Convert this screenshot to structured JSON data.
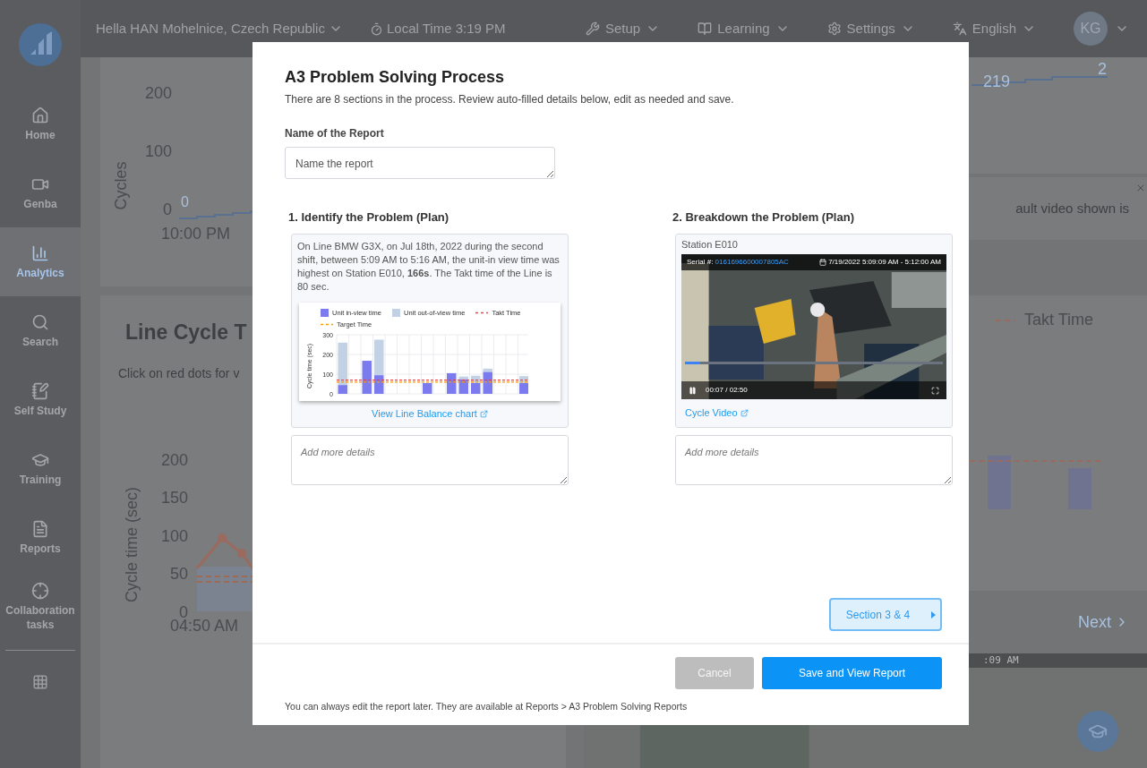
{
  "top_bar": {
    "site": "Hella HAN Mohelnice, Czech Republic",
    "local_time": "Local Time 3:19 PM",
    "menus": [
      {
        "kind": "setup",
        "label": "Setup"
      },
      {
        "kind": "learning",
        "label": "Learning"
      },
      {
        "kind": "settings",
        "label": "Settings"
      },
      {
        "kind": "language",
        "label": "English"
      }
    ],
    "avatar": "KG"
  },
  "sidebar": {
    "items": [
      {
        "kind": "home",
        "label": "Home",
        "selected": false
      },
      {
        "kind": "video",
        "label": "Genba",
        "selected": false
      },
      {
        "kind": "analytics",
        "label": "Analytics",
        "selected": true
      },
      {
        "kind": "search",
        "label": "Search",
        "selected": false
      },
      {
        "kind": "study",
        "label": "Self Study",
        "selected": false
      },
      {
        "kind": "training",
        "label": "Training",
        "selected": false
      },
      {
        "kind": "reports",
        "label": "Reports",
        "selected": false
      },
      {
        "kind": "collab",
        "label": "Collaboration tasks",
        "selected": false
      }
    ]
  },
  "background": {
    "cycles_chart": {
      "ylabel": "Cycles",
      "yticks": [
        "200",
        "100",
        "0"
      ],
      "xtick": "10:00 PM",
      "start_label": "0",
      "mid_label": "219",
      "end_label": "2"
    },
    "notice": "ault video shown is",
    "legend": "Takt Time",
    "next_link": "Next",
    "video_time": ":09 AM",
    "line_chart": {
      "title": "Line Cycle T",
      "subtitle": "Click on red dots for v",
      "ylabel": "Cycle time (sec)",
      "yticks": [
        "200",
        "150",
        "100",
        "50",
        "0"
      ],
      "xtick": "04:50 AM"
    }
  },
  "modal": {
    "title": "A3 Problem Solving Process",
    "subtitle": "There are 8 sections in the process. Review auto-filled details below, edit as needed and save.",
    "name_label": "Name of the Report",
    "name_placeholder": "Name the report",
    "sections": [
      {
        "kind": "summary",
        "title": "1. Identify the Problem (Plan)",
        "text": "On Line BMW G3X, on Jul 18th, 2022 during the second shift, between 5:09 AM to 5:16 AM, the unit-in view time was highest on Station E010, **166s**. The Takt time of the Line is 80 sec.",
        "link": "View Line Balance chart",
        "details_placeholder": "Add more details",
        "chart_data": {
          "type": "bar",
          "stacked": true,
          "legend": "top",
          "ylabel": "Cycle time (sec)",
          "ylim": [
            0,
            300
          ],
          "yticks": [
            0,
            100,
            200,
            300
          ],
          "series": [
            {
              "name": "Unit in-view time",
              "color": "#7b7bef",
              "values": [
                45,
                null,
                168,
                95,
                null,
                null,
                null,
                55,
                null,
                105,
                75,
                55,
                112,
                null,
                null,
                55
              ]
            },
            {
              "name": "Unit out-of-view time",
              "color": "#c2d2e4",
              "values": [
                215,
                null,
                null,
                180,
                null,
                null,
                null,
                null,
                null,
                null,
                13,
                37,
                16,
                null,
                null,
                35
              ]
            }
          ],
          "ref_lines": [
            {
              "axis": "y",
              "value": 70,
              "label": "Takt Time",
              "color": "#ef4444"
            },
            {
              "axis": "y",
              "value": 60,
              "label": "Target Time",
              "color": "#f59e0b"
            }
          ]
        }
      },
      {
        "kind": "video",
        "title": "2. Breakdown the Problem (Plan)",
        "station": "Station E010",
        "serial_label": "Serial #:",
        "serial": "0161696600007805AC",
        "time_range": "7/19/2022 5:09:09 AM - 5:12:00 AM",
        "playback": "00:07 / 02:50",
        "level": 0.06,
        "link": "Cycle Video",
        "details_placeholder": "Add more details"
      }
    ],
    "next_section": "Section 3 & 4",
    "cancel": {
      "label": "Cancel",
      "disabled": true
    },
    "save": "Save and View Report",
    "note": "You can always edit the report later. They are available at Reports > A3 Problem Solving Reports"
  }
}
